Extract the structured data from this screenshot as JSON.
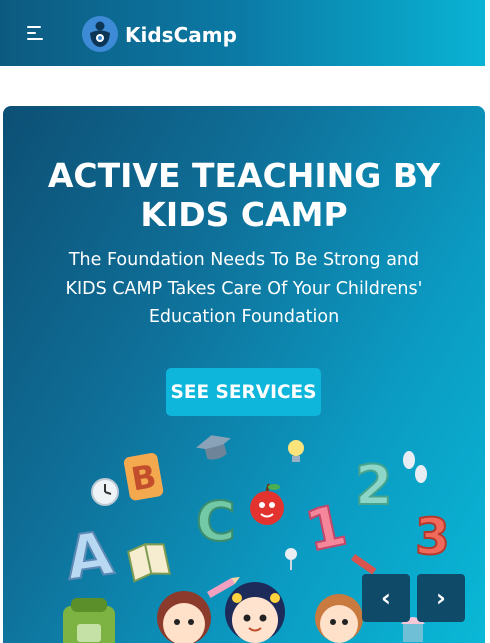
{
  "navbar": {
    "brand": "KidsCamp",
    "menu_icon": "hamburger-menu-icon",
    "logo_icon": "kids-logo-icon"
  },
  "hero": {
    "title_line1": "ACTIVE TEACHING BY",
    "title_line2": "KIDS CAMP",
    "subtitle_line1": "The Foundation Needs To Be Strong and",
    "subtitle_line2": "KIDS CAMP Takes Care Of Your Childrens'",
    "subtitle_line3": "Education Foundation",
    "cta_label": "SEE SERVICES",
    "prev_label": "‹",
    "next_label": "›"
  },
  "colors": {
    "navbar_start": "#0d5a80",
    "navbar_end": "#0ab3d4",
    "hero_start": "#0d4f74",
    "hero_end": "#0ab8d6",
    "cta": "#0fb6dc",
    "carousel_button": "#0f4a69"
  }
}
